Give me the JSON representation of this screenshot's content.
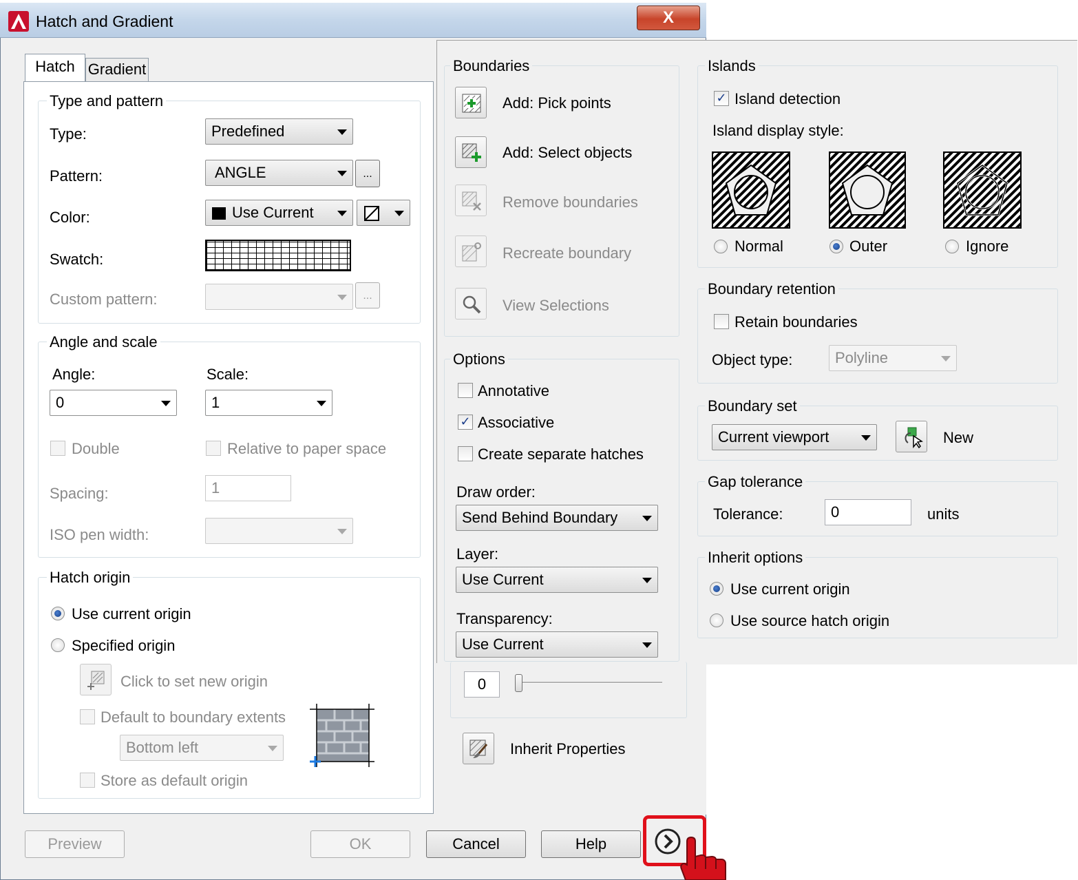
{
  "window": {
    "title": "Hatch and Gradient",
    "close_glyph": "X"
  },
  "tabs": [
    "Hatch",
    "Gradient"
  ],
  "type_pattern": {
    "group_label": "Type and pattern",
    "type_label": "Type:",
    "type_value": "Predefined",
    "pattern_label": "Pattern:",
    "pattern_value": "ANGLE",
    "browse_label": "...",
    "color_label": "Color:",
    "color_value": "Use Current",
    "swatch_label": "Swatch:",
    "custom_label": "Custom pattern:",
    "custom_browse_label": "..."
  },
  "angle_scale": {
    "group_label": "Angle and scale",
    "angle_label": "Angle:",
    "angle_value": "0",
    "scale_label": "Scale:",
    "scale_value": "1",
    "double_label": "Double",
    "relative_label": "Relative to paper space",
    "spacing_label": "Spacing:",
    "spacing_value": "1",
    "iso_label": "ISO pen width:"
  },
  "hatch_origin": {
    "group_label": "Hatch origin",
    "use_current_label": "Use current origin",
    "specified_label": "Specified origin",
    "click_label": "Click to set new origin",
    "default_label": "Default to boundary extents",
    "position_value": "Bottom left",
    "store_label": "Store as default origin"
  },
  "boundaries": {
    "group_label": "Boundaries",
    "add_pick": "Add: Pick points",
    "add_select": "Add: Select objects",
    "remove": "Remove boundaries",
    "recreate": "Recreate boundary",
    "view": "View Selections"
  },
  "options": {
    "group_label": "Options",
    "annotative": "Annotative",
    "associative": "Associative",
    "separate": "Create separate hatches",
    "draw_order_label": "Draw order:",
    "draw_order_value": "Send Behind Boundary",
    "layer_label": "Layer:",
    "layer_value": "Use Current",
    "transparency_label": "Transparency:",
    "transparency_value": "Use Current",
    "transparency_number": "0"
  },
  "inherit_properties": "Inherit Properties",
  "islands": {
    "group_label": "Islands",
    "detection_label": "Island detection",
    "style_label": "Island display style:",
    "normal_label": "Normal",
    "outer_label": "Outer",
    "ignore_label": "Ignore"
  },
  "boundary_retention": {
    "group_label": "Boundary retention",
    "retain_label": "Retain boundaries",
    "object_type_label": "Object type:",
    "object_type_value": "Polyline"
  },
  "boundary_set": {
    "group_label": "Boundary set",
    "value": "Current viewport",
    "new_label": "New"
  },
  "gap_tolerance": {
    "group_label": "Gap tolerance",
    "tolerance_label": "Tolerance:",
    "tolerance_value": "0",
    "units_label": "units"
  },
  "inherit_options": {
    "group_label": "Inherit options",
    "use_current": "Use current origin",
    "use_source": "Use source hatch origin"
  },
  "footer": {
    "preview": "Preview",
    "ok": "OK",
    "cancel": "Cancel",
    "help": "Help"
  },
  "colors": {
    "highlight": "#e0101a",
    "accent_blue": "#153d84",
    "add_green": "#1c9a2c"
  }
}
